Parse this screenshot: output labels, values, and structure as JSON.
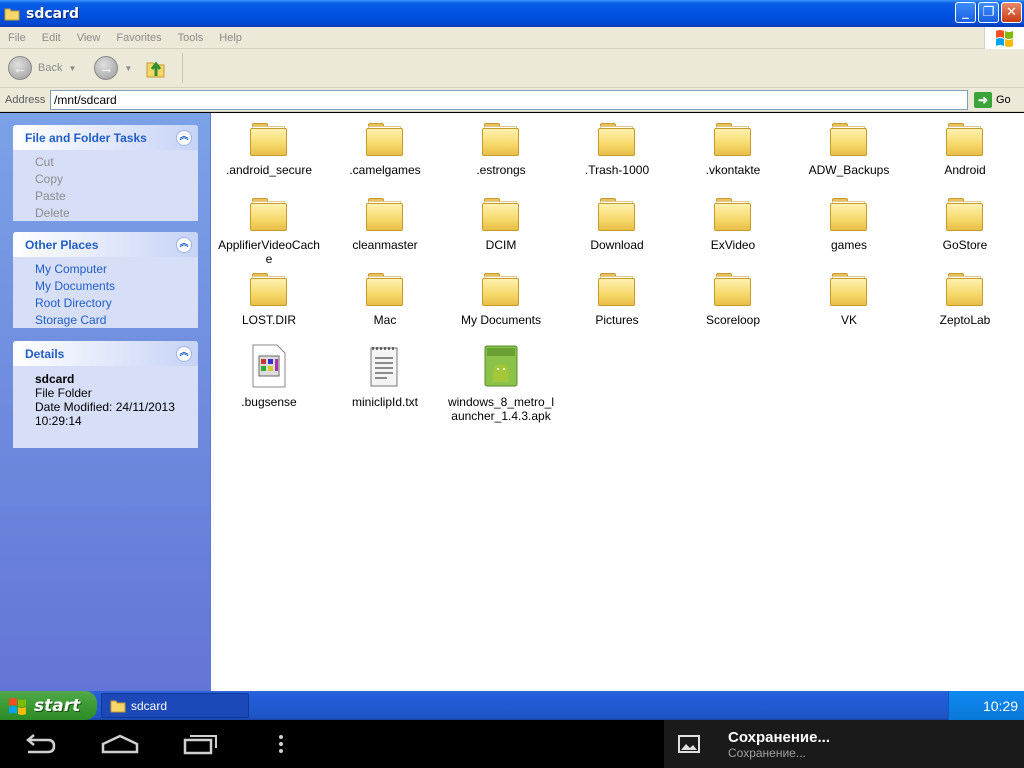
{
  "window": {
    "title": "sdcard",
    "minimize_label": "_",
    "maximize_label": "❐",
    "close_label": "✕"
  },
  "menu": [
    "File",
    "Edit",
    "View",
    "Favorites",
    "Tools",
    "Help"
  ],
  "toolbar": {
    "back_label": "Back",
    "back_icon": "←",
    "forward_icon": "→"
  },
  "address": {
    "label": "Address",
    "value": "/mnt/sdcard",
    "go_label": "Go",
    "go_icon": "➜"
  },
  "taskpane": {
    "file_tasks": {
      "title": "File and Folder Tasks",
      "collapse_icon": "︽",
      "items": [
        "Cut",
        "Copy",
        "Paste",
        "Delete"
      ]
    },
    "other_places": {
      "title": "Other Places",
      "collapse_icon": "︽",
      "items": [
        "My Computer",
        "My Documents",
        "Root Directory",
        "Storage Card"
      ]
    },
    "details": {
      "title": "Details",
      "collapse_icon": "︽",
      "name": "sdcard",
      "type": "File Folder",
      "modified": "Date Modified: 24/11/2013 10:29:14"
    }
  },
  "items": [
    {
      "label": ".android_secure",
      "kind": "folder"
    },
    {
      "label": ".camelgames",
      "kind": "folder"
    },
    {
      "label": ".estrongs",
      "kind": "folder"
    },
    {
      "label": ".Trash-1000",
      "kind": "folder"
    },
    {
      "label": ".vkontakte",
      "kind": "folder"
    },
    {
      "label": "ADW_Backups",
      "kind": "folder"
    },
    {
      "label": "Android",
      "kind": "folder"
    },
    {
      "label": "ApplifierVideoCache",
      "kind": "folder"
    },
    {
      "label": "cleanmaster",
      "kind": "folder"
    },
    {
      "label": "DCIM",
      "kind": "folder"
    },
    {
      "label": "Download",
      "kind": "folder"
    },
    {
      "label": "ExVideo",
      "kind": "folder"
    },
    {
      "label": "games",
      "kind": "folder"
    },
    {
      "label": "GoStore",
      "kind": "folder"
    },
    {
      "label": "LOST.DIR",
      "kind": "folder"
    },
    {
      "label": "Mac",
      "kind": "folder"
    },
    {
      "label": "My Documents",
      "kind": "folder"
    },
    {
      "label": "Pictures",
      "kind": "folder"
    },
    {
      "label": "Scoreloop",
      "kind": "folder"
    },
    {
      "label": "VK",
      "kind": "folder"
    },
    {
      "label": "ZeptoLab",
      "kind": "folder"
    },
    {
      "label": ".bugsense",
      "kind": "generic-file"
    },
    {
      "label": "miniclipId.txt",
      "kind": "text-file"
    },
    {
      "label": "windows_8_metro_launcher_1.4.3.apk",
      "kind": "apk-file"
    }
  ],
  "taskbar": {
    "start_label": "start",
    "task_label": "sdcard",
    "clock": "10:29"
  },
  "notification": {
    "title": "Сохранение...",
    "subtitle": "Сохранение..."
  },
  "colors": {
    "titlebar": "#0053e2",
    "taskpane_link": "#215dc6",
    "start_green": "#3b9a33"
  }
}
